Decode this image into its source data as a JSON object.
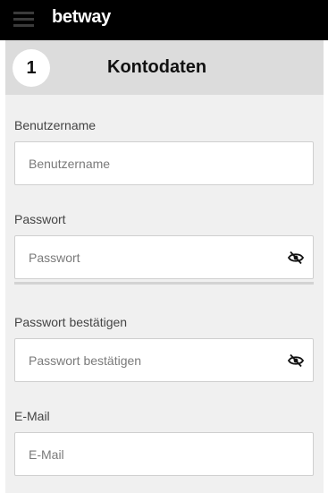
{
  "header": {
    "menu_icon": "hamburger-menu-icon",
    "logo_text": "betway"
  },
  "section": {
    "step_number": "1",
    "title": "Kontodaten"
  },
  "form": {
    "username": {
      "label": "Benutzername",
      "placeholder": "Benutzername",
      "value": ""
    },
    "password": {
      "label": "Passwort",
      "placeholder": "Passwort",
      "value": "",
      "toggle_icon": "eye-slash-icon"
    },
    "password_confirm": {
      "label": "Passwort bestätigen",
      "placeholder": "Passwort bestätigen",
      "value": "",
      "toggle_icon": "eye-slash-icon"
    },
    "email": {
      "label": "E-Mail",
      "placeholder": "E-Mail",
      "value": ""
    }
  },
  "colors": {
    "topbar": "#000000",
    "section_header": "#dcdcdc",
    "form_background": "#f0f0f0"
  }
}
